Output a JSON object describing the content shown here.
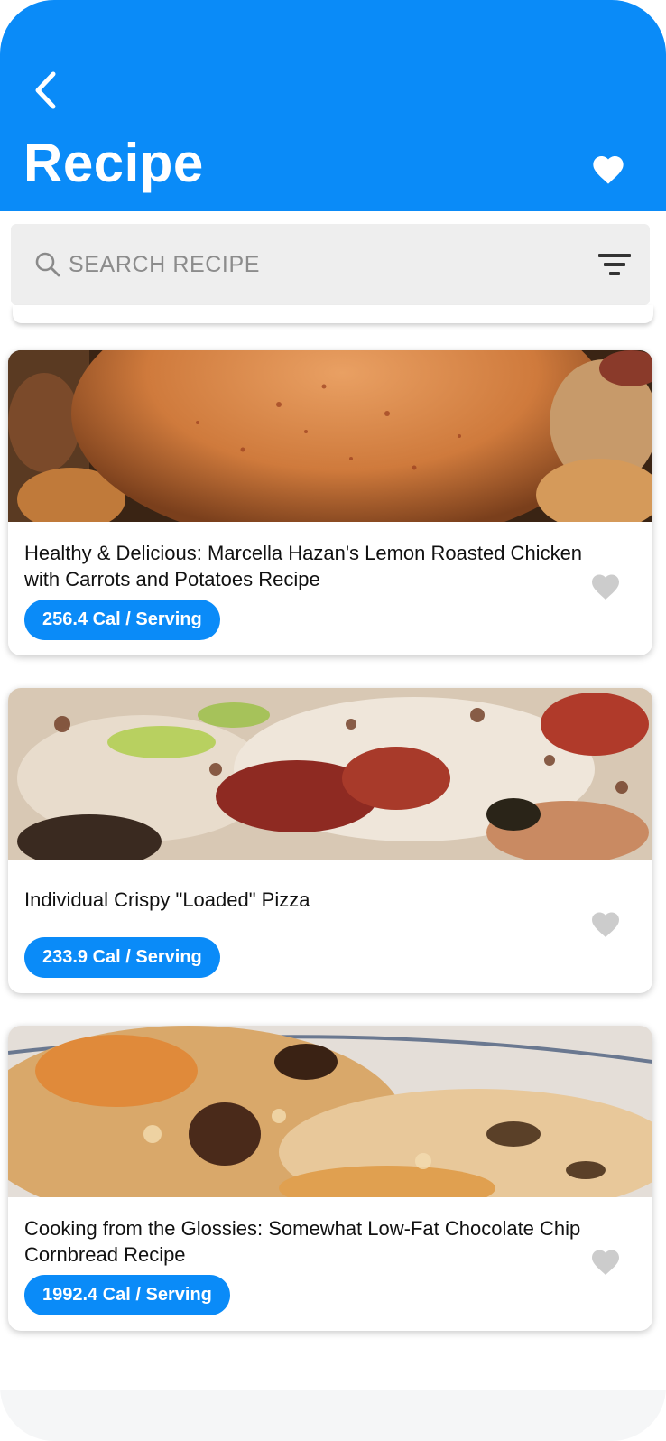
{
  "header": {
    "title": "Recipe",
    "back_icon": "chevron-left-icon",
    "favorites_icon": "heart-icon",
    "background_color": "#0a8bf8"
  },
  "search": {
    "placeholder": "SEARCH RECIPE",
    "value": "",
    "search_icon": "search-icon",
    "filter_icon": "filter-icon"
  },
  "recipes": [
    {
      "title": "Healthy & Delicious: Marcella Hazan's Lemon Roasted Chicken with Carrots and Potatoes Recipe",
      "calories": "256.4 Cal / Serving",
      "image": "roasted-chicken-photo",
      "favorite_icon": "heart-icon"
    },
    {
      "title": "Individual Crispy \"Loaded\" Pizza",
      "calories": "233.9 Cal / Serving",
      "image": "pizza-photo",
      "favorite_icon": "heart-icon"
    },
    {
      "title": "Cooking from the Glossies: Somewhat Low-Fat Chocolate Chip Cornbread Recipe",
      "calories": "1992.4 Cal / Serving",
      "image": "cornbread-photo",
      "favorite_icon": "heart-icon"
    }
  ],
  "colors": {
    "accent": "#0a8bf8",
    "favorite_inactive": "#cccccc"
  }
}
